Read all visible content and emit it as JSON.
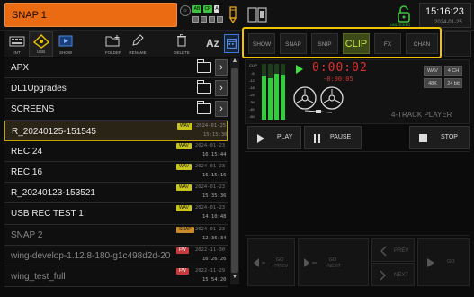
{
  "header": {
    "snapshot_name": "SNAP 1",
    "usb_badges": [
      "AB",
      "CP",
      "A",
      "B"
    ],
    "lock_label": "UNLOCKED",
    "time": "15:16:23",
    "date": "2024-01-25"
  },
  "toolbar": {
    "int_label": "INT",
    "usb_label": "USB",
    "show_label": "SHOW",
    "folder_label": "FOLDER",
    "rename_label": "RENAME",
    "delete_label": "DELETE",
    "sort_label": "Az"
  },
  "files": [
    {
      "name": "APX",
      "type": "folder"
    },
    {
      "name": "DL1Upgrades",
      "type": "folder"
    },
    {
      "name": "SCREENS",
      "type": "folder"
    },
    {
      "name": "R_20240125-151545",
      "badge": "WAV",
      "date": "2024-01-25",
      "time": "15:15:30",
      "selected": true
    },
    {
      "name": "REC 24",
      "badge": "WAV",
      "date": "2024-01-23",
      "time": "16:15:44"
    },
    {
      "name": "REC 16",
      "badge": "WAV",
      "date": "2024-01-23",
      "time": "16:15:16"
    },
    {
      "name": "R_20240123-153521",
      "badge": "WAV",
      "date": "2024-01-23",
      "time": "15:35:36"
    },
    {
      "name": "USB REC TEST 1",
      "badge": "WAV",
      "date": "2024-01-23",
      "time": "14:10:48"
    },
    {
      "name": "SNAP 2",
      "badge": "SNAP",
      "date": "2024-01-23",
      "time": "12:36:34",
      "dim": true
    },
    {
      "name": "wing-develop-1.12.8-180-g1c498d2d-20",
      "badge": "FW",
      "date": "2022-11-30",
      "time": "16:26:26",
      "dim": true
    },
    {
      "name": "wing_test_full",
      "badge": "FW",
      "date": "2022-11-29",
      "time": "15:54:20",
      "dim": true
    }
  ],
  "tabs": [
    {
      "label": "SHOW",
      "active": false
    },
    {
      "label": "SNAP",
      "active": false
    },
    {
      "label": "SNIP",
      "active": false
    },
    {
      "label": "CLIP",
      "active": true
    },
    {
      "label": "FX",
      "active": false
    },
    {
      "label": "CHAN",
      "active": false
    }
  ],
  "player": {
    "meter_labels": [
      "CLIP",
      "-6",
      "-12",
      "-18",
      "-24",
      "-30",
      "-40",
      "-60"
    ],
    "meter_levels": [
      0.78,
      0.75,
      0.82,
      0.8
    ],
    "timecode": "0:00:02",
    "remaining": "-0:00:05",
    "format_badges": [
      "WAV",
      "4 CH",
      "48K",
      "24 bit"
    ],
    "tracks_label": "4-TRACK PLAYER"
  },
  "transport": {
    "play_label": "PLAY",
    "pause_label": "PAUSE",
    "stop_label": "STOP"
  },
  "navigation": {
    "prev_go_label": "GO\n+PREV",
    "next_go_label": "GO\n+NEXT",
    "prev_label": "PREV",
    "next_label": "NEXT",
    "go_label": "GO"
  },
  "colors": {
    "snap_accent": "#ea6b12",
    "mode_highlight": "#f0c500",
    "clip_tab": "#c8e34a",
    "selected_row": "#c9a200"
  }
}
